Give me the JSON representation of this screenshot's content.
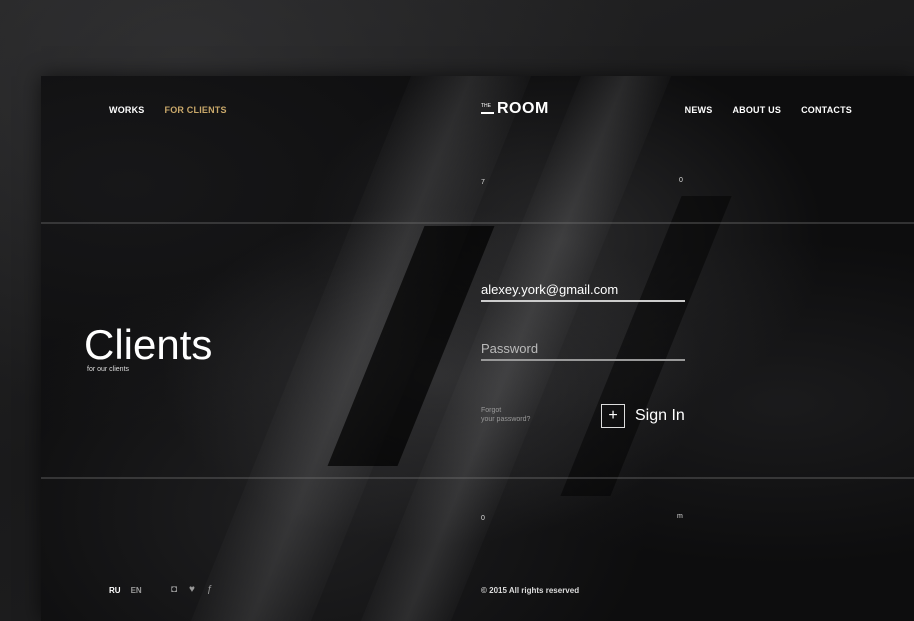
{
  "nav": {
    "left": [
      {
        "label": "WORKS"
      },
      {
        "label": "FOR CLIENTS"
      }
    ],
    "right": [
      {
        "label": "NEWS"
      },
      {
        "label": "ABOUT US"
      },
      {
        "label": "CONTACTS"
      }
    ]
  },
  "logo": {
    "small": "THE",
    "main": "ROOM"
  },
  "markers": {
    "top_left": "7",
    "top_right": "0",
    "bottom_left": "0",
    "bottom_right": "m"
  },
  "hero": {
    "title": "Clients",
    "subtitle": "for our clients"
  },
  "form": {
    "email_value": "alexey.york@gmail.com",
    "password_placeholder": "Password",
    "forgot_label": "Forgot\nyour password?",
    "signin_icon": "+",
    "signin_label": "Sign In"
  },
  "footer": {
    "lang": [
      "RU",
      "EN"
    ],
    "social": [
      "instagram-icon",
      "twitter-icon",
      "facebook-icon"
    ],
    "copyright": "© 2015 All rights reserved"
  },
  "colors": {
    "active_nav": "#c9a86a",
    "background": "#0b0b0c"
  }
}
